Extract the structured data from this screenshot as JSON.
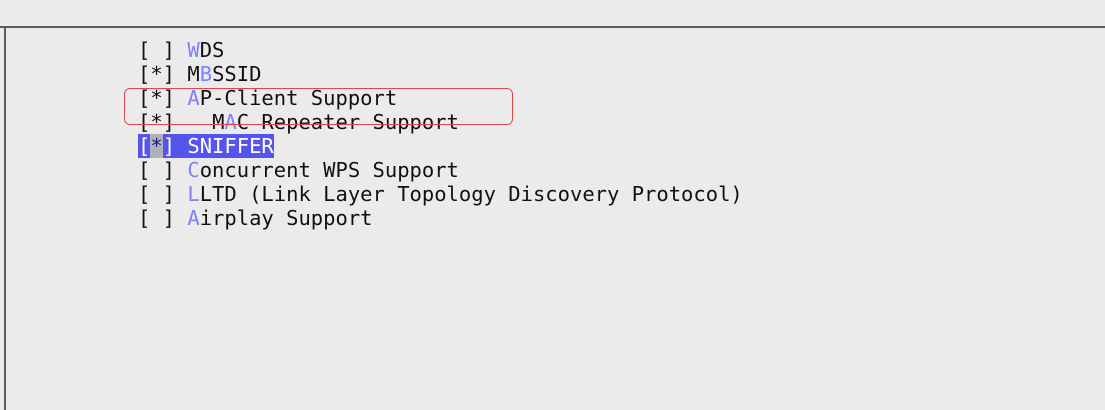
{
  "menu": {
    "items": [
      {
        "checkbox": "[ ]",
        "indent": "",
        "hotkey": "W",
        "rest": "DS",
        "selected": false
      },
      {
        "checkbox": "[*]",
        "indent": "",
        "hotkey": "M",
        "rest": "",
        "hotkey2": "B",
        "rest2": "SSID",
        "selected": false
      },
      {
        "checkbox": "[*]",
        "indent": "",
        "hotkey": "A",
        "rest": "P-Client Support",
        "selected": false
      },
      {
        "checkbox": "[*]",
        "indent": "  ",
        "hotkey": "M",
        "rest": "",
        "hotkey2": "A",
        "rest2": "C Repeater Support",
        "selected": false
      },
      {
        "checkbox_open": "[",
        "checkbox_mark": "*",
        "checkbox_close": "]",
        "indent": "",
        "hotkey": "S",
        "rest": "NIFFER",
        "selected": true
      },
      {
        "checkbox": "[ ]",
        "indent": "",
        "hotkey": "C",
        "rest": "oncurrent WPS Support",
        "selected": false
      },
      {
        "checkbox": "[ ]",
        "indent": "",
        "hotkey": "L",
        "rest": "LTD (Link Layer Topology Discovery Protocol)",
        "selected": false
      },
      {
        "checkbox": "[ ]",
        "indent": "",
        "hotkey": "A",
        "rest": "irplay Support",
        "selected": false
      }
    ]
  },
  "colors": {
    "background": "#ebebeb",
    "hotkey": "#8080ff",
    "selection": "#5555ee",
    "annotation": "#e24747"
  }
}
